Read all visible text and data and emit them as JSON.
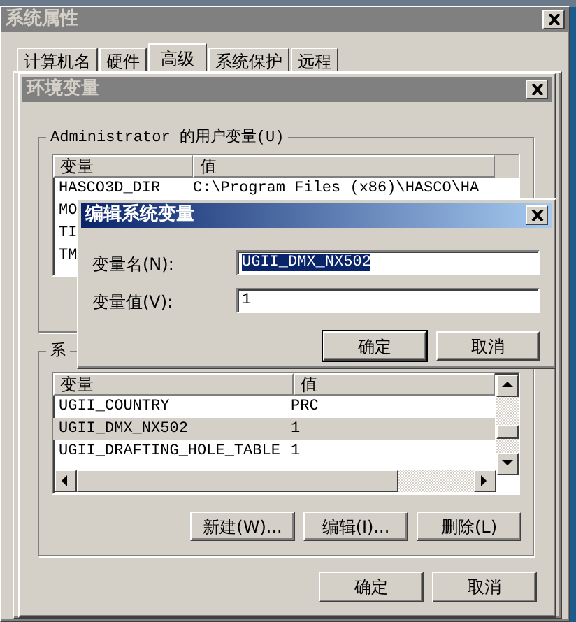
{
  "system_properties": {
    "title": "系统属性",
    "tabs": [
      {
        "label": "计算机名",
        "selected": false
      },
      {
        "label": "硬件",
        "selected": false
      },
      {
        "label": "高级",
        "selected": true
      },
      {
        "label": "系统保护",
        "selected": false
      },
      {
        "label": "远程",
        "selected": false
      }
    ]
  },
  "environment_window": {
    "title": "环境变量",
    "user_group": {
      "label": "Administrator 的用户变量(U)",
      "columns": [
        "变量",
        "值"
      ],
      "rows": [
        {
          "name": "HASCO3D_DIR",
          "value": "C:\\Program Files (x86)\\HASCO\\HA"
        },
        {
          "name": "MO"
        },
        {
          "name": "TI"
        },
        {
          "name": "TM"
        }
      ]
    },
    "system_group": {
      "label": "系",
      "columns": [
        "变量",
        "值"
      ],
      "rows": [
        {
          "name": "UGII_COUNTRY",
          "value": "PRC",
          "selected": false
        },
        {
          "name": "UGII_DMX_NX502",
          "value": "1",
          "selected": true
        },
        {
          "name": "UGII_DRAFTING_HOLE_TABLE",
          "value": "1",
          "selected": false
        }
      ],
      "buttons": [
        "新建(W)...",
        "编辑(I)...",
        "删除(L)"
      ]
    },
    "buttons": [
      "确定",
      "取消"
    ]
  },
  "edit_dialog": {
    "title": "编辑系统变量",
    "fields": [
      {
        "label": "变量名(N):",
        "value": "UGII_DMX_NX502",
        "text_selected": true
      },
      {
        "label": "变量值(V):",
        "value": "1",
        "text_selected": false
      }
    ],
    "buttons": [
      {
        "label": "确定",
        "default": true
      },
      {
        "label": "取消",
        "default": false
      }
    ]
  }
}
